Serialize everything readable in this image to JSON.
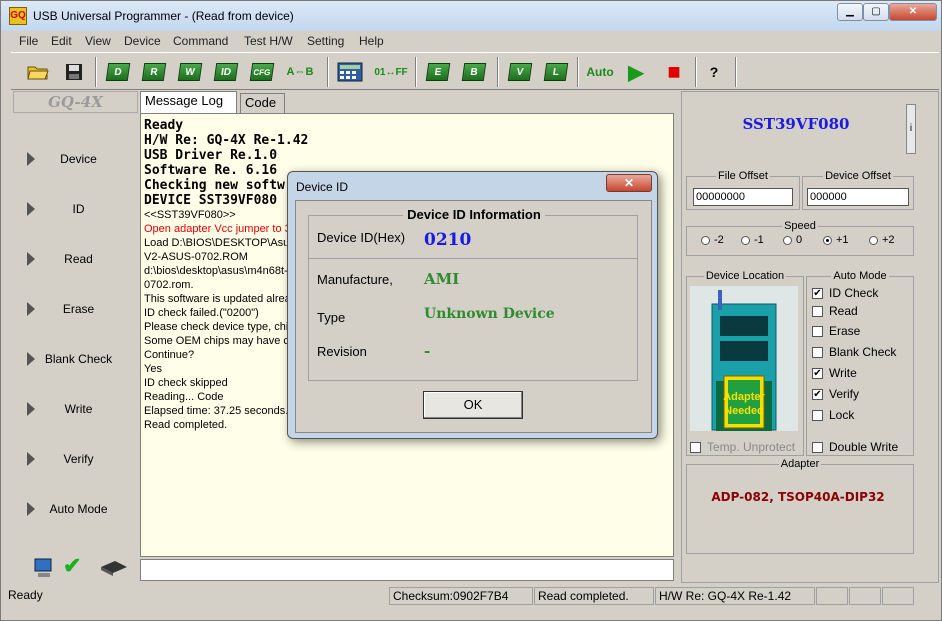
{
  "window": {
    "title": "USB Universal Programmer - (Read from device)",
    "min": "▁",
    "max": "▢",
    "close": "✕"
  },
  "menu": [
    "File",
    "Edit",
    "View",
    "Device",
    "Command",
    "Test H/W",
    "Setting",
    "Help"
  ],
  "toolbar": {
    "open": "open-icon",
    "save": "save-icon",
    "device": "D",
    "read": "R",
    "write": "W",
    "id": "ID",
    "cfg": "CFG",
    "compare": "A⇔B",
    "calc": "calculator-icon",
    "fill": "01↔FF",
    "erase": "E",
    "blank": "B",
    "verify": "V",
    "lock": "L",
    "auto": "Auto",
    "play": "▶",
    "stop": "■",
    "help": "?"
  },
  "sidebar": {
    "brand": "GQ-4X",
    "items": [
      "Device",
      "ID",
      "Read",
      "Erase",
      "Blank Check",
      "Write",
      "Verify",
      "Auto Mode"
    ],
    "status_check": "✔"
  },
  "tabs": [
    "Message Log",
    "Code"
  ],
  "log_mono": [
    "Ready",
    "H/W Re: GQ-4X Re-1.42",
    "USB Driver Re.1.0",
    "Software Re. 6.16",
    "Checking new softw",
    "DEVICE SST39VF080"
  ],
  "log_small": [
    {
      "text": "<<SST39VF080>>",
      "color": "#000000"
    },
    {
      "text": "Open adapter Vcc jumper to 3",
      "color": "#e00000"
    },
    {
      "text": "Load D:\\BIOS\\DESKTOP\\Asus",
      "color": "#000000"
    },
    {
      "text": "V2-ASUS-0702.ROM",
      "color": "#000000"
    },
    {
      "text": "d:\\bios\\desktop\\asus\\m4n68t-",
      "color": "#000000"
    },
    {
      "text": "0702.rom.",
      "color": "#000000"
    },
    {
      "text": "This software is updated alrea",
      "color": "#000000"
    },
    {
      "text": "ID check failed.(\"0200\")",
      "color": "#000000"
    },
    {
      "text": "Please check device type, chi",
      "color": "#000000"
    },
    {
      "text": "Some OEM chips may have co",
      "color": "#000000"
    },
    {
      "text": "Continue?",
      "color": "#000000"
    },
    {
      "text": "Yes",
      "color": "#000000"
    },
    {
      "text": "ID check skipped",
      "color": "#000000"
    },
    {
      "text": "Reading... Code",
      "color": "#000000"
    },
    {
      "text": "Elapsed time: 37.25 seconds.",
      "color": "#000000"
    },
    {
      "text": "Read completed.",
      "color": "#000000"
    }
  ],
  "right": {
    "chip": "SST39VF080",
    "info_btn": "i",
    "file_offset_label": "File Offset",
    "file_offset": "00000000",
    "device_offset_label": "Device Offset",
    "device_offset": "000000",
    "speed_label": "Speed",
    "speed_options": [
      "-2",
      "-1",
      "0",
      "+1",
      "+2"
    ],
    "speed_selected": "+1",
    "device_location_label": "Device Location",
    "adapter_needed": "Adapter Needed",
    "temp_unprotect": "Temp. Unprotect",
    "auto_mode_label": "Auto Mode",
    "auto_options": [
      {
        "label": "ID Check",
        "checked": true
      },
      {
        "label": "Read",
        "checked": false
      },
      {
        "label": "Erase",
        "checked": false
      },
      {
        "label": "Blank Check",
        "checked": false
      },
      {
        "label": "Write",
        "checked": true
      },
      {
        "label": "Verify",
        "checked": true
      },
      {
        "label": "Lock",
        "checked": false
      }
    ],
    "double_write": "Double Write",
    "adapter_label": "Adapter",
    "adapter_value": "ADP-082, TSOP40A-DIP32"
  },
  "status": {
    "ready": "Ready",
    "checksum": "Checksum:0902F7B4",
    "message": "Read completed.",
    "hw": "H/W Re: GQ-4X Re-1.42"
  },
  "dialog": {
    "title": "Device ID",
    "close": "✕",
    "group_title": "Device ID Information",
    "id_label": "Device ID(Hex)",
    "id_value": "0210",
    "manufacture_label": "Manufacture,",
    "manufacture_value": "AMI",
    "type_label": "Type",
    "type_value": "Unknown Device",
    "revision_label": "Revision",
    "revision_value": "-",
    "ok": "OK"
  },
  "colors": {
    "accent_blue": "#1a1ae0",
    "value_green": "#2e8b2e",
    "adapter_red": "#8b0000",
    "error_red": "#e00000"
  }
}
